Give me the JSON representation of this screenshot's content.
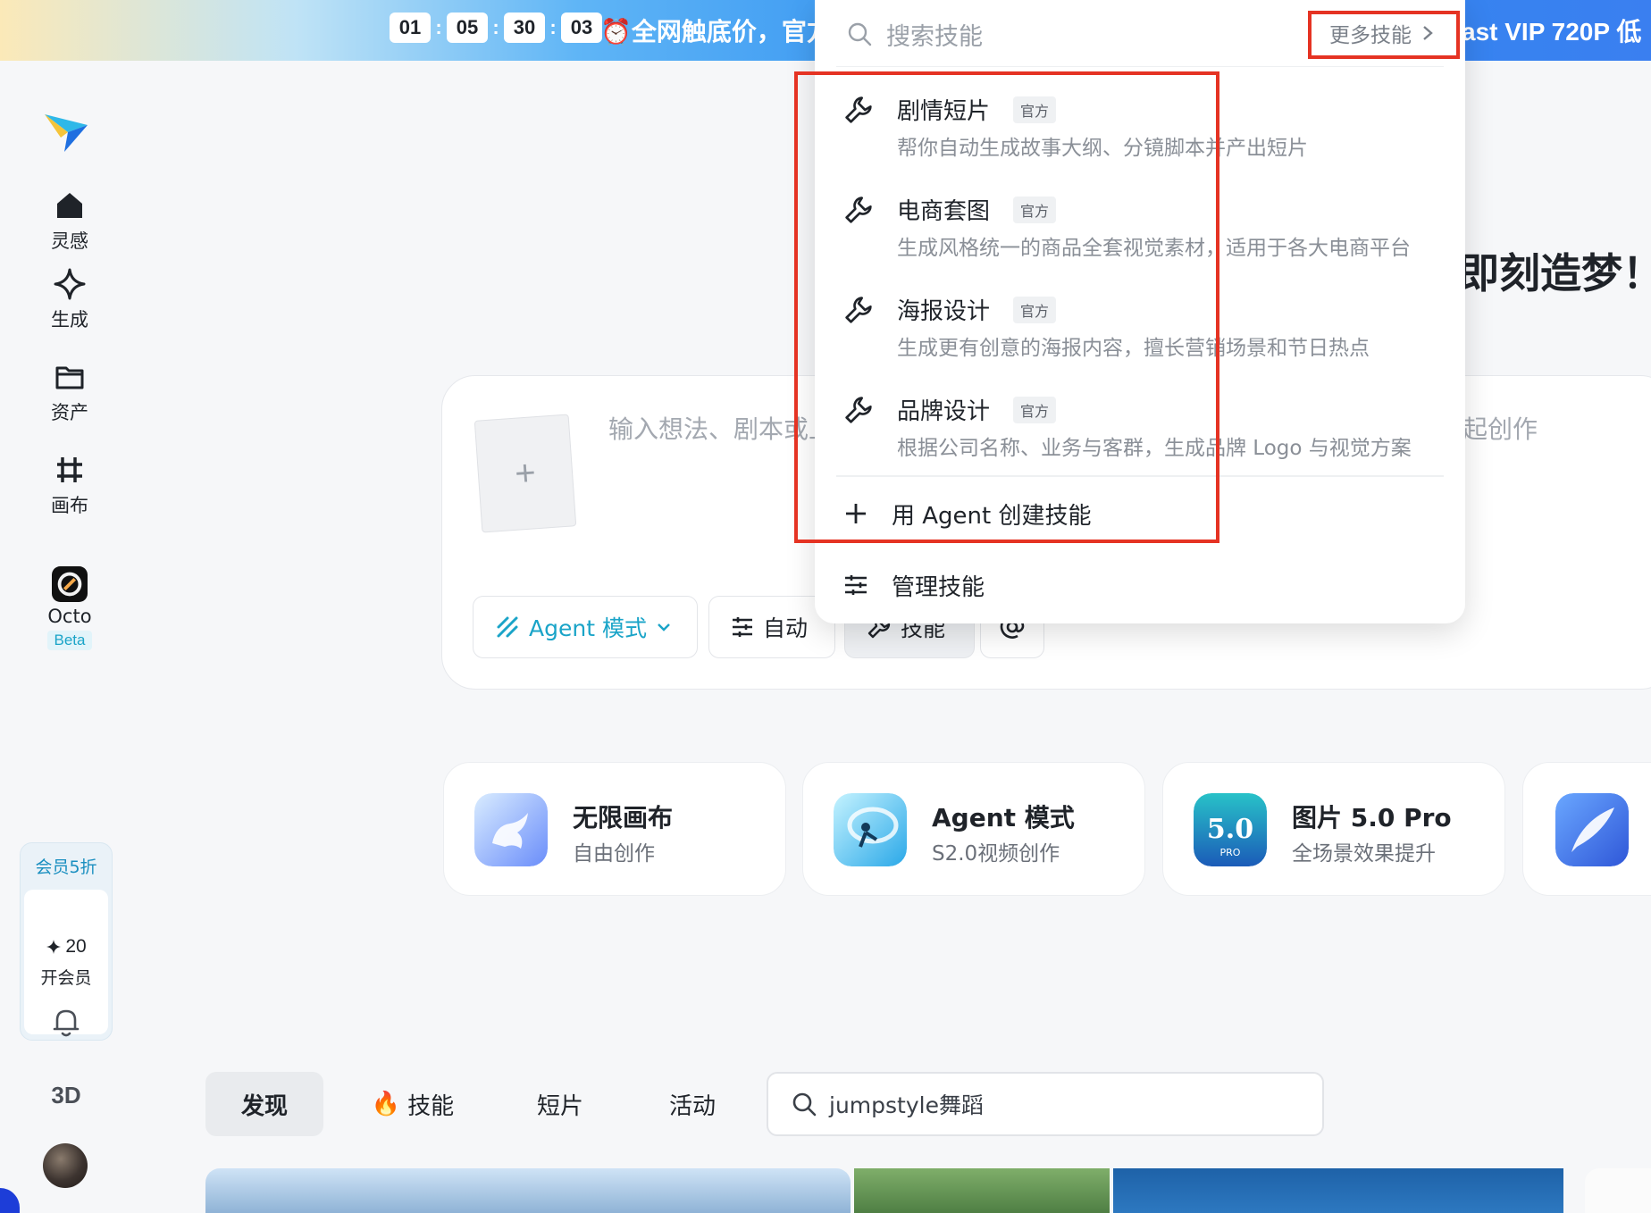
{
  "banner": {
    "timer": [
      "01",
      "05",
      "30",
      "03"
    ],
    "promo_left": "⏰全网触底价，官方",
    "promo_right": "ast VIP 720P 低"
  },
  "sidebar": {
    "nav": [
      {
        "label": "灵感",
        "icon": "home-icon"
      },
      {
        "label": "生成",
        "icon": "sparkle-icon"
      },
      {
        "label": "资产",
        "icon": "folder-icon"
      },
      {
        "label": "画布",
        "icon": "canvas-icon"
      },
      {
        "label": "Octo",
        "icon": "octo-app-icon",
        "badge": "Beta"
      }
    ],
    "member": {
      "promo": "会员5折",
      "credits": "20",
      "open_label": "开会员"
    },
    "label_3d": "3D"
  },
  "main": {
    "headline": "即刻造梦！",
    "prompt_placeholder": "输入想法、剧本或上",
    "prompt_placeholder_right": "起创作",
    "upload_plus": "+",
    "chips": {
      "agent": "Agent 模式",
      "auto": "自动",
      "skill": "技能"
    }
  },
  "features": [
    {
      "title": "无限画布",
      "subtitle": "自由创作",
      "icon": "pegasus-app-icon"
    },
    {
      "title": "Agent 模式",
      "subtitle": "S2.0视频创作",
      "icon": "agent-app-icon"
    },
    {
      "title": "图片 5.0 Pro",
      "subtitle": "全场景效果提升",
      "icon": "image-5-pro-icon",
      "icon_text": "5.0",
      "icon_sub": "PRO"
    },
    {
      "title": "",
      "subtitle": "",
      "icon": "feather-app-icon"
    }
  ],
  "tabs": [
    {
      "label": "发现",
      "active": true
    },
    {
      "label": "技能",
      "icon": "🔥"
    },
    {
      "label": "短片"
    },
    {
      "label": "活动"
    }
  ],
  "search": {
    "value": "jumpstyle舞蹈"
  },
  "dropdown": {
    "search_placeholder": "搜索技能",
    "more_label": "更多技能",
    "items": [
      {
        "title": "剧情短片",
        "badge": "官方",
        "desc": "帮你自动生成故事大纲、分镜脚本并产出短片"
      },
      {
        "title": "电商套图",
        "badge": "官方",
        "desc": "生成风格统一的商品全套视觉素材，适用于各大电商平台"
      },
      {
        "title": "海报设计",
        "badge": "官方",
        "desc": "生成更有创意的海报内容，擅长营销场景和节日热点"
      },
      {
        "title": "品牌设计",
        "badge": "官方",
        "desc": "根据公司名称、业务与客群，生成品牌 Logo 与视觉方案"
      }
    ],
    "create_label": "用 Agent 创建技能",
    "manage_label": "管理技能"
  },
  "colors": {
    "accent": "#1aa4c8",
    "annotation_red": "#e53323",
    "banner_blue": "#2f8ef0"
  }
}
